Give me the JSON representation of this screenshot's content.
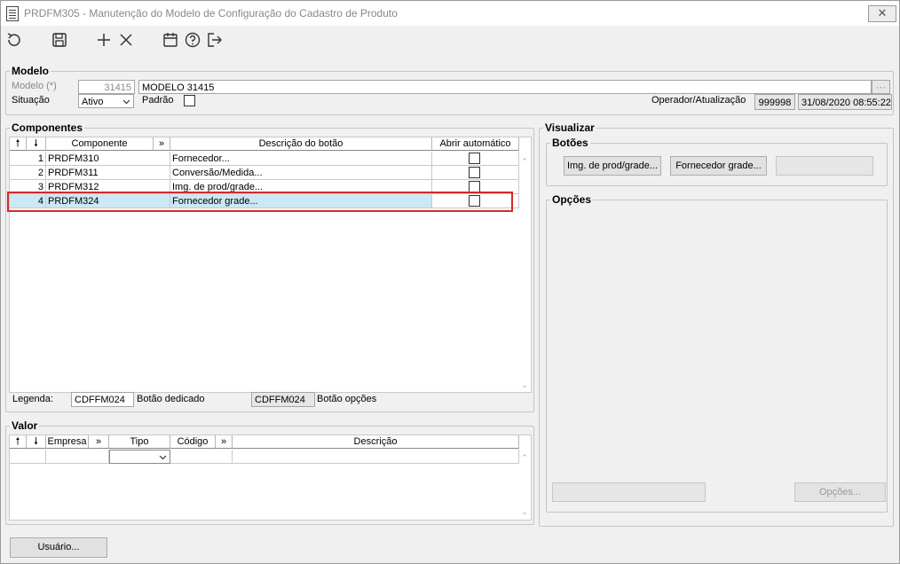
{
  "window": {
    "title": "PRDFM305 - Manutenção do Modelo de Configuração do Cadastro de Produto",
    "close_label": "✕"
  },
  "toolbar": {
    "items": [
      "undo-icon",
      "save-icon",
      "add-icon",
      "delete-icon",
      "calendar-icon",
      "help-icon",
      "exit-icon"
    ]
  },
  "modelo": {
    "title": "Modelo",
    "modelo_label": "Modelo (*)",
    "modelo_code": "31415",
    "modelo_name": "MODELO 31415",
    "situacao_label": "Situação",
    "situacao_value": "Ativo",
    "padrao_label": "Padrão",
    "operador_label": "Operador/Atualização",
    "operador_value": "999998",
    "datetime_value": "31/08/2020 08:55:22"
  },
  "componentes": {
    "title": "Componentes",
    "headers": {
      "up": "🠕",
      "down": "🠗",
      "componente": "Componente",
      "more": "»",
      "descricao": "Descrição do botão",
      "abrir": "Abrir automático"
    },
    "rows": [
      {
        "num": "1",
        "componente": "PRDFM310",
        "descricao": "Fornecedor...",
        "abrir": false
      },
      {
        "num": "2",
        "componente": "PRDFM311",
        "descricao": "Conversão/Medida...",
        "abrir": false
      },
      {
        "num": "3",
        "componente": "PRDFM312",
        "descricao": "Img. de prod/grade...",
        "abrir": false
      },
      {
        "num": "4",
        "componente": "PRDFM324",
        "descricao": "Fornecedor grade...",
        "abrir": false
      }
    ],
    "selected_row": 4,
    "legenda_label": "Legenda:",
    "legenda_dedicado_code": "CDFFM024",
    "legenda_dedicado_label": "Botão dedicado",
    "legenda_opcoes_code": "CDFFM024",
    "legenda_opcoes_label": "Botão opções"
  },
  "valor": {
    "title": "Valor",
    "headers": {
      "up": "🠕",
      "down": "🠗",
      "empresa": "Empresa",
      "more1": "»",
      "tipo": "Tipo",
      "codigo": "Código",
      "more2": "»",
      "descricao": "Descrição"
    }
  },
  "visualizar": {
    "title": "Visualizar",
    "botoes_title": "Botões",
    "buttons": [
      "Img. de prod/grade...",
      "Fornecedor grade..."
    ],
    "opcoes_title": "Opções",
    "opcoes_button": "Opções..."
  },
  "footer": {
    "usuario_button": "Usuário..."
  },
  "colors": {
    "selection": "#cde8f5",
    "highlight": "#d22b2b"
  }
}
